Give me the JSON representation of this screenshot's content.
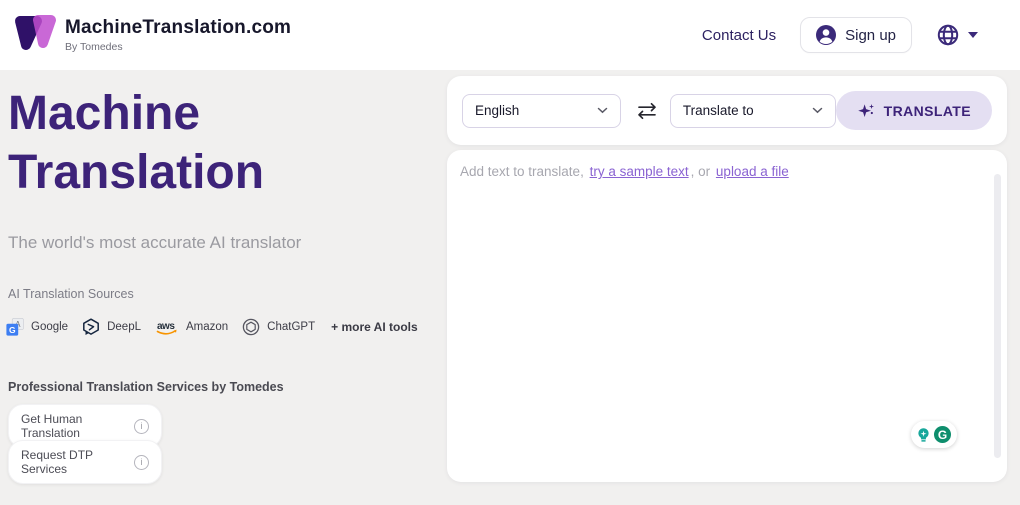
{
  "header": {
    "brand_title": "MachineTranslation.com",
    "brand_subtitle": "By Tomedes",
    "contact_label": "Contact Us",
    "signup_label": "Sign up"
  },
  "hero": {
    "title_line1": "Machine",
    "title_line2": "Translation",
    "subtitle": "The world's most accurate AI translator",
    "sources_label": "AI Translation Sources",
    "sources": [
      {
        "name": "Google",
        "icon": "google-translate-icon"
      },
      {
        "name": "DeepL",
        "icon": "deepl-icon"
      },
      {
        "name": "Amazon",
        "icon": "aws-icon",
        "icon_text": "aws"
      },
      {
        "name": "ChatGPT",
        "icon": "chatgpt-icon"
      }
    ],
    "more_tools_label": "+ more AI tools",
    "services_heading": "Professional Translation Services by Tomedes",
    "service_buttons": [
      {
        "label": "Get Human Translation"
      },
      {
        "label": "Request DTP Services"
      }
    ],
    "info_glyph": "i"
  },
  "translator": {
    "source_language": "English",
    "target_language_placeholder": "Translate to",
    "translate_label": "TRANSLATE",
    "placeholder_prefix": "Add text to translate,",
    "sample_link_label": "try a sample text",
    "separator_label": ", or",
    "upload_link_label": "upload a file",
    "editor_value": "",
    "grammarly_glyph": "G"
  },
  "colors": {
    "brand_purple": "#3d2379",
    "link_purple": "#8a63d2",
    "translate_button_bg": "#e4dff2",
    "page_background": "#f1f0ef",
    "deepl_navy": "#16263f",
    "google_blue": "#3d7ef2",
    "aws_orange": "#f79400",
    "grammarly_green": "#0e8e6d",
    "bulb_teal": "#18a79b"
  }
}
